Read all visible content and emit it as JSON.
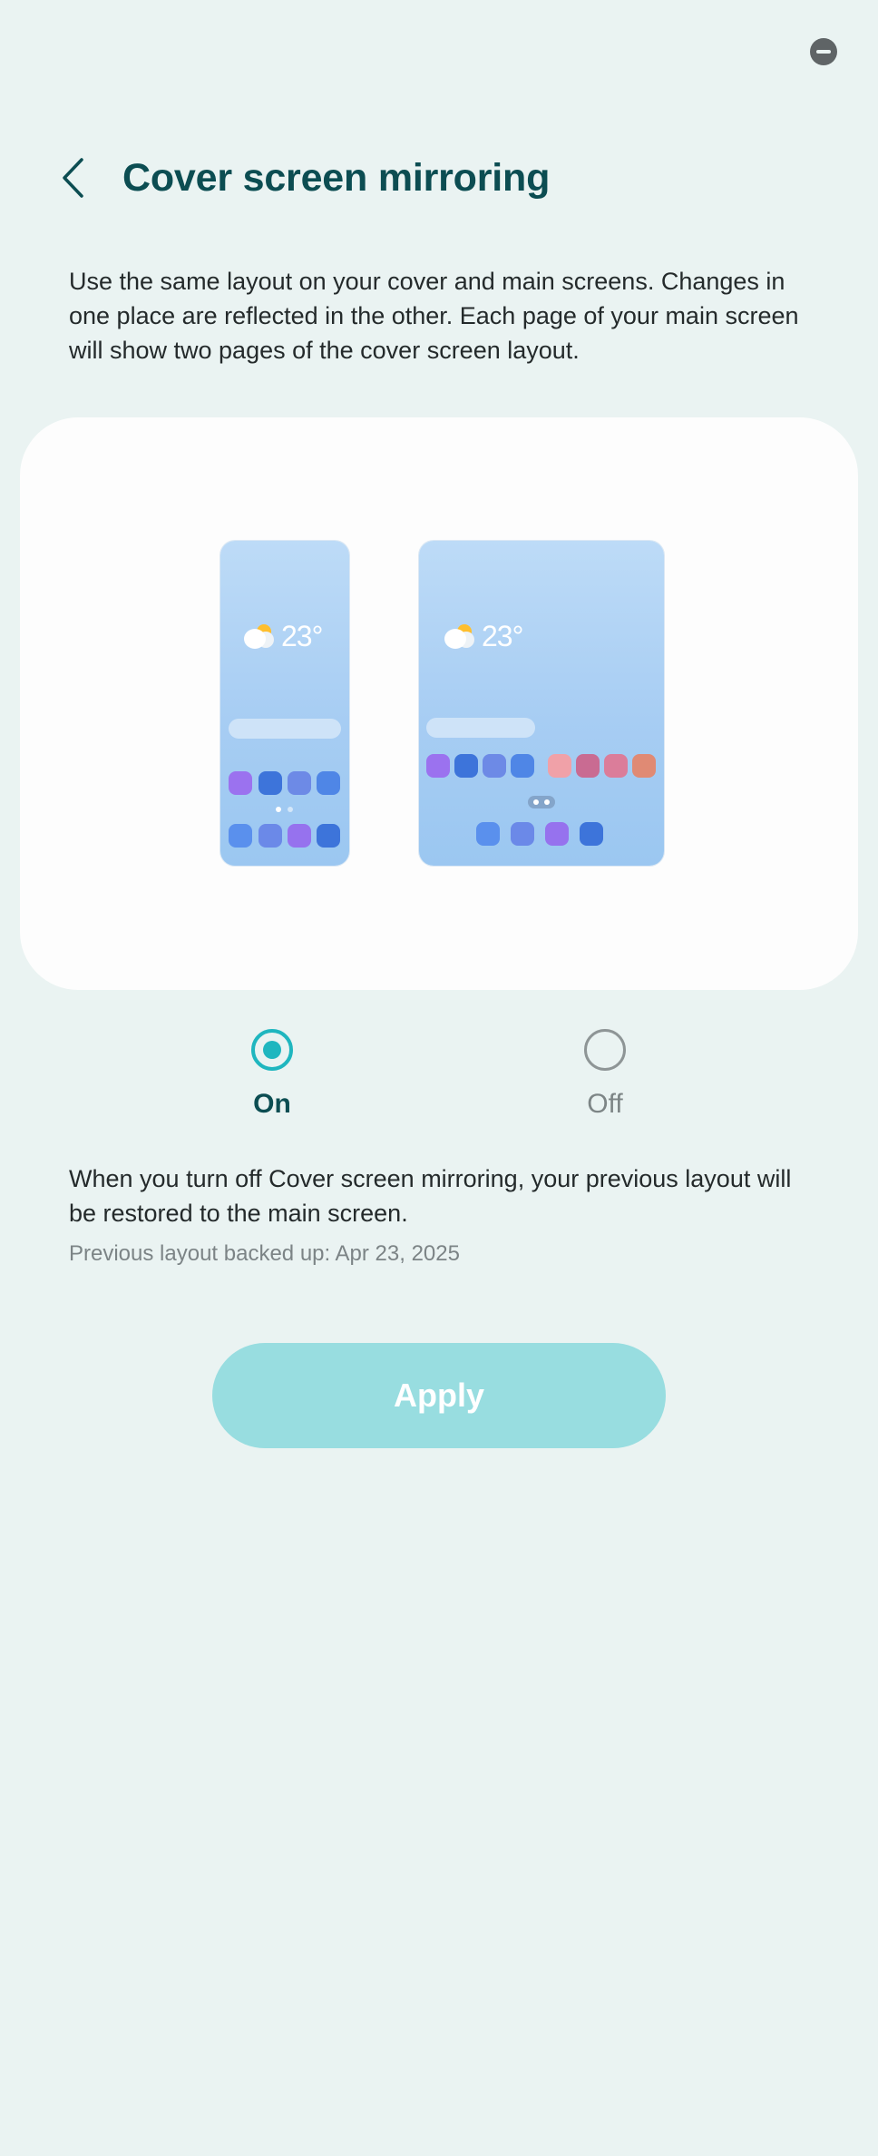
{
  "header": {
    "title": "Cover screen mirroring",
    "back_icon": "chevron-left-icon"
  },
  "status_bar": {
    "icon": "do-not-disturb-icon"
  },
  "description": "Use the same layout on your cover and main screens. Changes in one place are reflected in the other. Each page of your main screen will show two pages of the cover screen layout.",
  "preview": {
    "cover_temp": "23°",
    "main_temp": "23°"
  },
  "options": {
    "on_label": "On",
    "off_label": "Off",
    "selected": "On"
  },
  "info": {
    "text": "When you turn off Cover screen mirroring, your previous layout will be restored to the main screen.",
    "backup": "Previous layout backed up: Apr 23, 2025"
  },
  "apply_label": "Apply",
  "colors": {
    "background": "#eaf3f2",
    "title": "#0c4d52",
    "accent": "#1fb6bf",
    "apply_button": "#98dde0"
  }
}
